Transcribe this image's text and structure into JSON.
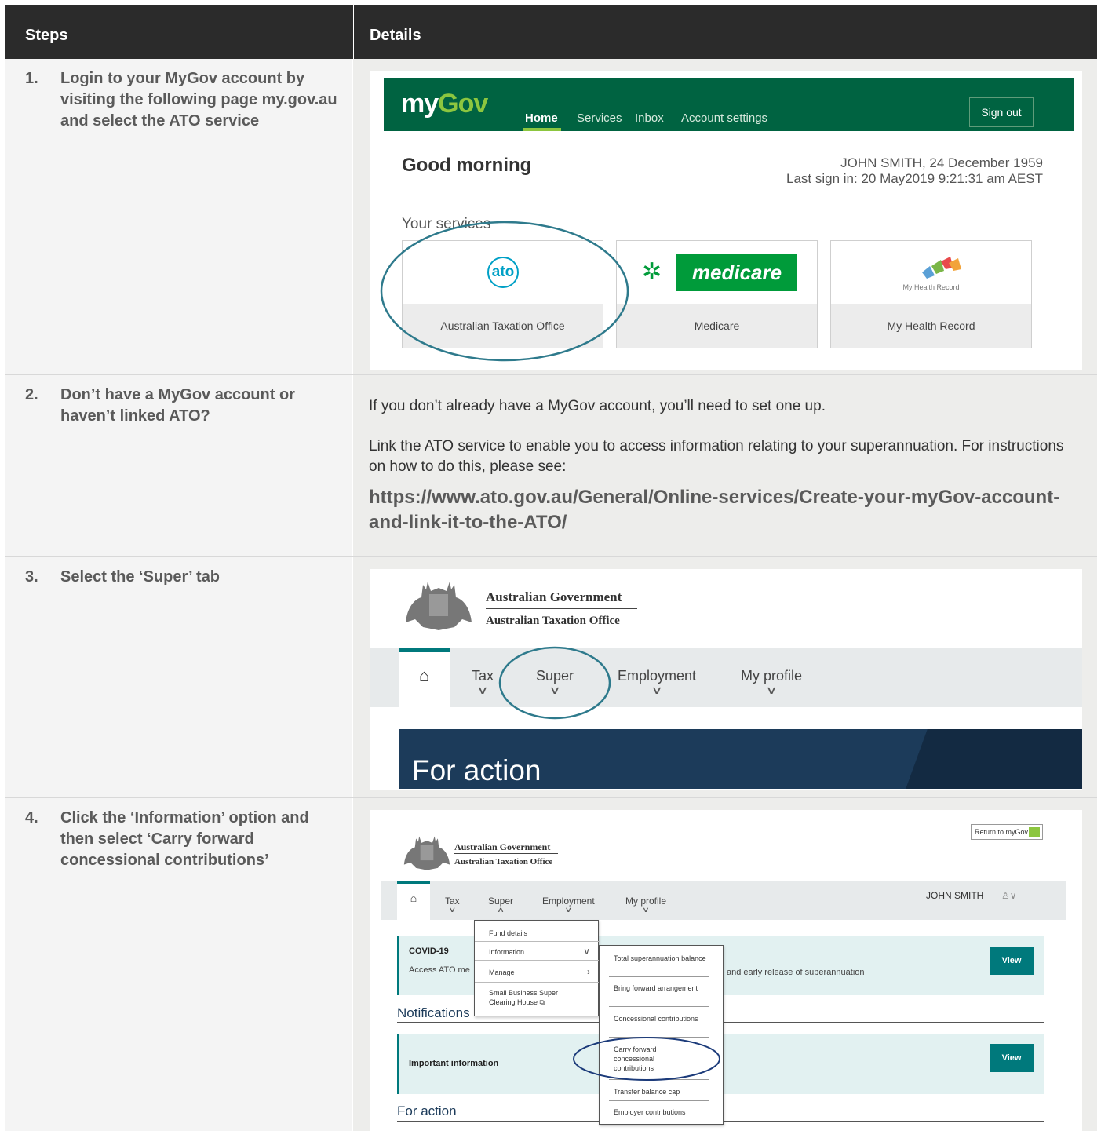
{
  "table": {
    "header_steps": "Steps",
    "header_details": "Details"
  },
  "steps": [
    {
      "num": "1.",
      "text": "Login to your MyGov account by visiting the following page my.gov.au and select the ATO service"
    },
    {
      "num": "2.",
      "text": "Don’t have a MyGov account or haven’t linked ATO?"
    },
    {
      "num": "3.",
      "text": "Select the ‘Super’ tab"
    },
    {
      "num": "4.",
      "text": "Click the ‘Information’ option and then select ‘Carry forward concessional contributions’"
    }
  ],
  "mygov": {
    "logo_my": "my",
    "logo_gov": "Gov",
    "nav": [
      "Home",
      "Services",
      "Inbox",
      "Account settings"
    ],
    "sign_out": "Sign out",
    "greeting": "Good morning",
    "user_line": "JOHN SMITH, 24 December 1959",
    "last_sign_in": "Last sign in: 20 May2019   9:21:31 am AEST",
    "your_services": "Your services",
    "tiles": [
      "Australian Taxation Office",
      "Medicare",
      "My Health Record"
    ],
    "ato_logo": "ato",
    "medicare_logo": "medicare",
    "mhr_logo": "My Health Record",
    "highlight_color": "#2e7a8c"
  },
  "details2": {
    "p1": "If you don’t already have a MyGov account, you’ll need to set one up.",
    "p2": "Link the ATO service to enable you to access information relating to your superannuation. For instructions on how to do this, please see:",
    "link": "https://www.ato.gov.au/General/Online-services/Create-your-myGov-account-and-link-it-to-the-ATO/"
  },
  "ato3": {
    "gov_name": "Australian Government",
    "office_name": "Australian Taxation Office",
    "home_icon": "home-icon",
    "nav": [
      "Tax",
      "Super",
      "Employment",
      "My profile"
    ],
    "for_action": "For action"
  },
  "ato4": {
    "gov_name": "Australian Government",
    "office_name": "Australian Taxation Office",
    "return_label": "Return to myGov",
    "nav": [
      "Tax",
      "Super",
      "Employment",
      "My profile"
    ],
    "user": "JOHN SMITH",
    "covid_title": "COVID-19",
    "covid_text_a": "Access ATO me",
    "covid_text_b": "and early release of superannuation",
    "view": "View",
    "notifications": "Notifications",
    "important": "Important information",
    "for_action": "For action",
    "super_menu": [
      "Fund details",
      "Information",
      "Manage",
      "Small Business Super Clearing House"
    ],
    "info_menu": [
      "Total superannuation balance",
      "Bring forward arrangement",
      "Concessional contributions",
      "Carry forward concessional contributions",
      "Transfer balance cap",
      "Employer contributions"
    ]
  }
}
